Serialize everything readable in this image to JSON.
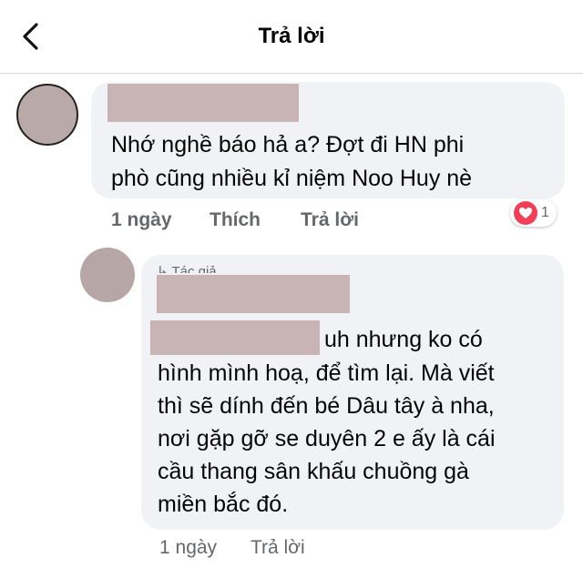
{
  "header": {
    "title": "Trả lời",
    "back_icon": "chevron-left-icon"
  },
  "comment": {
    "lines": [
      "Nhớ nghề báo hả a? Đợt đi HN phi",
      "phò cũng nhiều kỉ niệm Noo Huy nè"
    ],
    "time": "1 ngày",
    "like_label": "Thích",
    "reply_label": "Trả lời",
    "reaction": {
      "icon": "heart-icon",
      "count": "1",
      "color": "#f33e58"
    }
  },
  "reply": {
    "reply_to": "↳ Tác giả",
    "lines": [
      "uh nhưng ko có",
      "hình mình hoạ, để tìm lại. Mà viết",
      "thì sẽ dính đến bé Dâu tây à nha,",
      "nơi gặp gỡ se duyên 2 e ấy là cái",
      "cầu thang sân khấu chuồng gà",
      "miền bắc đó."
    ],
    "time": "1 ngày",
    "reply_label": "Trả lời"
  }
}
